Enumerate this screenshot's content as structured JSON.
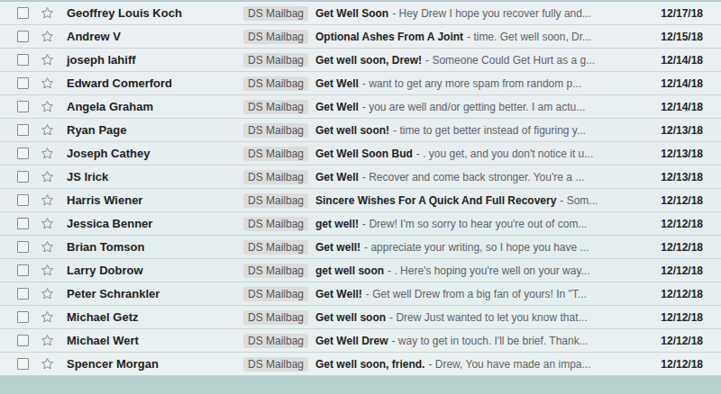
{
  "inbox": {
    "rows": [
      {
        "sender": "Geoffrey Louis Koch",
        "label": "DS Mailbag",
        "subject": "Get Well Soon",
        "snippet": "- Hey Drew I hope you recover fully and...",
        "date": "12/17/18",
        "checked": false,
        "starred": false,
        "unread": true
      },
      {
        "sender": "Andrew V",
        "label": "DS Mailbag",
        "subject": "Optional Ashes From A Joint",
        "snippet": "- time. Get well soon, Dr...",
        "date": "12/15/18",
        "checked": false,
        "starred": false,
        "unread": true
      },
      {
        "sender": "joseph lahiff",
        "label": "DS Mailbag",
        "subject": "Get well soon, Drew!",
        "snippet": "- Someone Could Get Hurt as a g...",
        "date": "12/14/18",
        "checked": false,
        "starred": false,
        "unread": true
      },
      {
        "sender": "Edward Comerford",
        "label": "DS Mailbag",
        "subject": "Get Well",
        "snippet": "- want to get any more spam from random p...",
        "date": "12/14/18",
        "checked": false,
        "starred": false,
        "unread": true
      },
      {
        "sender": "Angela Graham",
        "label": "DS Mailbag",
        "subject": "Get Well",
        "snippet": "- you are well and/or getting better. I am actu...",
        "date": "12/14/18",
        "checked": false,
        "starred": false,
        "unread": true
      },
      {
        "sender": "Ryan Page",
        "label": "DS Mailbag",
        "subject": "Get well soon!",
        "snippet": "- time to get better instead of figuring y...",
        "date": "12/13/18",
        "checked": false,
        "starred": false,
        "unread": true
      },
      {
        "sender": "Joseph Cathey",
        "label": "DS Mailbag",
        "subject": "Get Well Soon Bud",
        "snippet": "- . you get, and you don't notice it u...",
        "date": "12/13/18",
        "checked": false,
        "starred": false,
        "unread": true
      },
      {
        "sender": "JS Irick",
        "label": "DS Mailbag",
        "subject": "Get Well",
        "snippet": "- Recover and come back stronger. You're a ...",
        "date": "12/13/18",
        "checked": false,
        "starred": false,
        "unread": true
      },
      {
        "sender": "Harris Wiener",
        "label": "DS Mailbag",
        "subject": "Sincere Wishes For A Quick And Full Recovery",
        "snippet": "- Som...",
        "date": "12/12/18",
        "checked": false,
        "starred": false,
        "unread": true
      },
      {
        "sender": "Jessica Benner",
        "label": "DS Mailbag",
        "subject": "get well!",
        "snippet": "- Drew! I'm so sorry to hear you're out of com...",
        "date": "12/12/18",
        "checked": false,
        "starred": false,
        "unread": true
      },
      {
        "sender": "Brian Tomson",
        "label": "DS Mailbag",
        "subject": "Get well!",
        "snippet": "- appreciate your writing, so I hope you have ...",
        "date": "12/12/18",
        "checked": false,
        "starred": false,
        "unread": true
      },
      {
        "sender": "Larry Dobrow",
        "label": "DS Mailbag",
        "subject": "get well soon",
        "snippet": "- . Here's hoping you're well on your way...",
        "date": "12/12/18",
        "checked": false,
        "starred": false,
        "unread": true
      },
      {
        "sender": "Peter Schrankler",
        "label": "DS Mailbag",
        "subject": "Get Well!",
        "snippet": "- Get well Drew from a big fan of yours! In \"T...",
        "date": "12/12/18",
        "checked": false,
        "starred": false,
        "unread": true
      },
      {
        "sender": "Michael Getz",
        "label": "DS Mailbag",
        "subject": "Get well soon",
        "snippet": "- Drew Just wanted to let you know that...",
        "date": "12/12/18",
        "checked": false,
        "starred": false,
        "unread": true
      },
      {
        "sender": "Michael Wert",
        "label": "DS Mailbag",
        "subject": "Get Well Drew",
        "snippet": "- way to get in touch. I'll be brief. Thank...",
        "date": "12/12/18",
        "checked": false,
        "starred": false,
        "unread": true
      },
      {
        "sender": "Spencer Morgan",
        "label": "DS Mailbag",
        "subject": "Get well soon, friend.",
        "snippet": "- Drew, You have made an impa...",
        "date": "12/12/18",
        "checked": false,
        "starred": false,
        "unread": true
      }
    ]
  }
}
